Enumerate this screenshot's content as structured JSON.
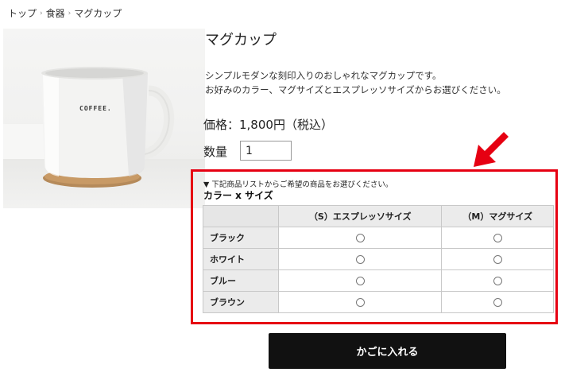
{
  "breadcrumb": [
    "トップ",
    "食器",
    "マグカップ"
  ],
  "breadcrumb_separator": "›",
  "product": {
    "image_label": "COFFEE.",
    "title": "マグカップ",
    "description_lines": [
      "シンプルモダンな刻印入りのおしゃれなマグカップです。",
      "お好みのカラー、マグサイズとエスプレッソサイズからお選びください。"
    ],
    "price": "価格：1,800円（税込）",
    "quantity_label": "数量",
    "quantity_value": "1"
  },
  "options": {
    "hint": "▼ 下記商品リストからご希望の商品をお選びください。",
    "title": "カラー x サイズ",
    "columns": [
      "（S）エスプレッソサイズ",
      "（M）マグサイズ"
    ],
    "rows": [
      "ブラック",
      "ホワイト",
      "ブルー",
      "ブラウン"
    ]
  },
  "cart_button_label": "かごに入れる",
  "colors": {
    "highlight": "#e60012",
    "button_bg": "#111111",
    "header_bg": "#ebebeb"
  }
}
